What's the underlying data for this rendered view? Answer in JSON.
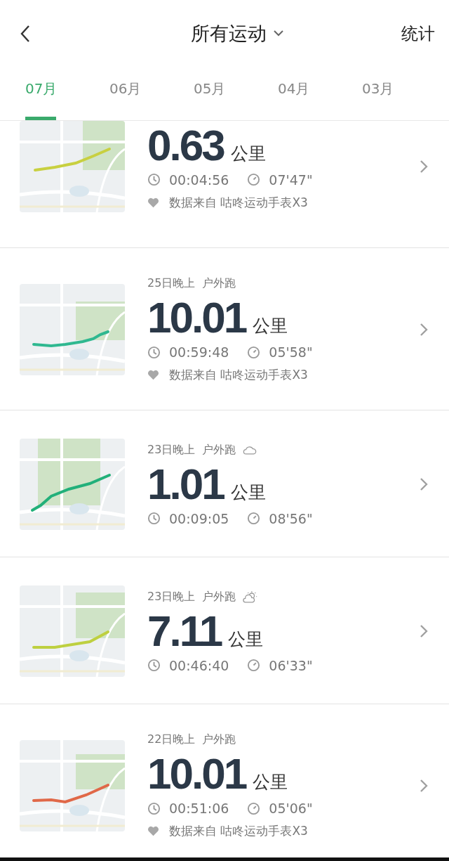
{
  "header": {
    "title": "所有运动",
    "action": "统计"
  },
  "tabs": [
    {
      "label": "07月",
      "selected": true
    },
    {
      "label": "06月",
      "selected": false
    },
    {
      "label": "05月",
      "selected": false
    },
    {
      "label": "04月",
      "selected": false
    },
    {
      "label": "03月",
      "selected": false
    }
  ],
  "activities": [
    {
      "distance": "0.63",
      "unit": "公里",
      "duration": "00:04:56",
      "pace": "07'47\"",
      "source": "数据来自 咕咚运动手表X3"
    },
    {
      "date": "25日晚上",
      "type": "户外跑",
      "distance": "10.01",
      "unit": "公里",
      "duration": "00:59:48",
      "pace": "05'58\"",
      "source": "数据来自 咕咚运动手表X3"
    },
    {
      "date": "23日晚上",
      "type": "户外跑",
      "weather": {
        "kind": "cloud"
      },
      "distance": "1.01",
      "unit": "公里",
      "duration": "00:09:05",
      "pace": "08'56\""
    },
    {
      "date": "23日晚上",
      "type": "户外跑",
      "weather": {
        "kind": "sun-cloud"
      },
      "distance": "7.11",
      "unit": "公里",
      "duration": "00:46:40",
      "pace": "06'33\""
    },
    {
      "date": "22日晚上",
      "type": "户外跑",
      "distance": "10.01",
      "unit": "公里",
      "duration": "00:51:06",
      "pace": "05'06\"",
      "source": "数据来自 咕咚运动手表X3"
    }
  ]
}
